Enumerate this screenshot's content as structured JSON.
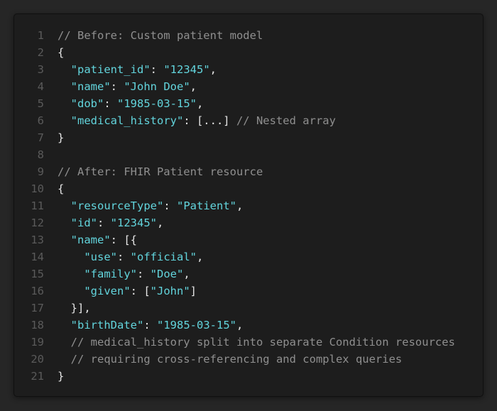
{
  "colors": {
    "background": "#262626",
    "panel": "#1d1d1d",
    "line_number": "#5a5a5a",
    "comment": "#8f8f8f",
    "key": "#62d4dc",
    "string": "#62d4dc",
    "punctuation": "#e6e6e6"
  },
  "code": {
    "lines": [
      {
        "n": "1",
        "tokens": [
          {
            "t": "c",
            "v": "// Before: Custom patient model"
          }
        ]
      },
      {
        "n": "2",
        "tokens": [
          {
            "t": "p",
            "v": "{"
          }
        ]
      },
      {
        "n": "3",
        "tokens": [
          {
            "t": "p",
            "v": "  "
          },
          {
            "t": "k",
            "v": "\"patient_id\""
          },
          {
            "t": "p",
            "v": ": "
          },
          {
            "t": "s",
            "v": "\"12345\""
          },
          {
            "t": "p",
            "v": ","
          }
        ]
      },
      {
        "n": "4",
        "tokens": [
          {
            "t": "p",
            "v": "  "
          },
          {
            "t": "k",
            "v": "\"name\""
          },
          {
            "t": "p",
            "v": ": "
          },
          {
            "t": "s",
            "v": "\"John Doe\""
          },
          {
            "t": "p",
            "v": ","
          }
        ]
      },
      {
        "n": "5",
        "tokens": [
          {
            "t": "p",
            "v": "  "
          },
          {
            "t": "k",
            "v": "\"dob\""
          },
          {
            "t": "p",
            "v": ": "
          },
          {
            "t": "s",
            "v": "\"1985-03-15\""
          },
          {
            "t": "p",
            "v": ","
          }
        ]
      },
      {
        "n": "6",
        "tokens": [
          {
            "t": "p",
            "v": "  "
          },
          {
            "t": "k",
            "v": "\"medical_history\""
          },
          {
            "t": "p",
            "v": ": [...] "
          },
          {
            "t": "c",
            "v": "// Nested array"
          }
        ]
      },
      {
        "n": "7",
        "tokens": [
          {
            "t": "p",
            "v": "}"
          }
        ]
      },
      {
        "n": "8",
        "tokens": []
      },
      {
        "n": "9",
        "tokens": [
          {
            "t": "c",
            "v": "// After: FHIR Patient resource"
          }
        ]
      },
      {
        "n": "10",
        "tokens": [
          {
            "t": "p",
            "v": "{"
          }
        ]
      },
      {
        "n": "11",
        "tokens": [
          {
            "t": "p",
            "v": "  "
          },
          {
            "t": "k",
            "v": "\"resourceType\""
          },
          {
            "t": "p",
            "v": ": "
          },
          {
            "t": "s",
            "v": "\"Patient\""
          },
          {
            "t": "p",
            "v": ","
          }
        ]
      },
      {
        "n": "12",
        "tokens": [
          {
            "t": "p",
            "v": "  "
          },
          {
            "t": "k",
            "v": "\"id\""
          },
          {
            "t": "p",
            "v": ": "
          },
          {
            "t": "s",
            "v": "\"12345\""
          },
          {
            "t": "p",
            "v": ","
          }
        ]
      },
      {
        "n": "13",
        "tokens": [
          {
            "t": "p",
            "v": "  "
          },
          {
            "t": "k",
            "v": "\"name\""
          },
          {
            "t": "p",
            "v": ": [{"
          }
        ]
      },
      {
        "n": "14",
        "tokens": [
          {
            "t": "p",
            "v": "    "
          },
          {
            "t": "k",
            "v": "\"use\""
          },
          {
            "t": "p",
            "v": ": "
          },
          {
            "t": "s",
            "v": "\"official\""
          },
          {
            "t": "p",
            "v": ","
          }
        ]
      },
      {
        "n": "15",
        "tokens": [
          {
            "t": "p",
            "v": "    "
          },
          {
            "t": "k",
            "v": "\"family\""
          },
          {
            "t": "p",
            "v": ": "
          },
          {
            "t": "s",
            "v": "\"Doe\""
          },
          {
            "t": "p",
            "v": ","
          }
        ]
      },
      {
        "n": "16",
        "tokens": [
          {
            "t": "p",
            "v": "    "
          },
          {
            "t": "k",
            "v": "\"given\""
          },
          {
            "t": "p",
            "v": ": ["
          },
          {
            "t": "s",
            "v": "\"John\""
          },
          {
            "t": "p",
            "v": "]"
          }
        ]
      },
      {
        "n": "17",
        "tokens": [
          {
            "t": "p",
            "v": "  }],"
          }
        ]
      },
      {
        "n": "18",
        "tokens": [
          {
            "t": "p",
            "v": "  "
          },
          {
            "t": "k",
            "v": "\"birthDate\""
          },
          {
            "t": "p",
            "v": ": "
          },
          {
            "t": "s",
            "v": "\"1985-03-15\""
          },
          {
            "t": "p",
            "v": ","
          }
        ]
      },
      {
        "n": "19",
        "tokens": [
          {
            "t": "p",
            "v": "  "
          },
          {
            "t": "c",
            "v": "// medical_history split into separate Condition resources"
          }
        ]
      },
      {
        "n": "20",
        "tokens": [
          {
            "t": "p",
            "v": "  "
          },
          {
            "t": "c",
            "v": "// requiring cross-referencing and complex queries"
          }
        ]
      },
      {
        "n": "21",
        "tokens": [
          {
            "t": "p",
            "v": "}"
          }
        ]
      }
    ]
  }
}
